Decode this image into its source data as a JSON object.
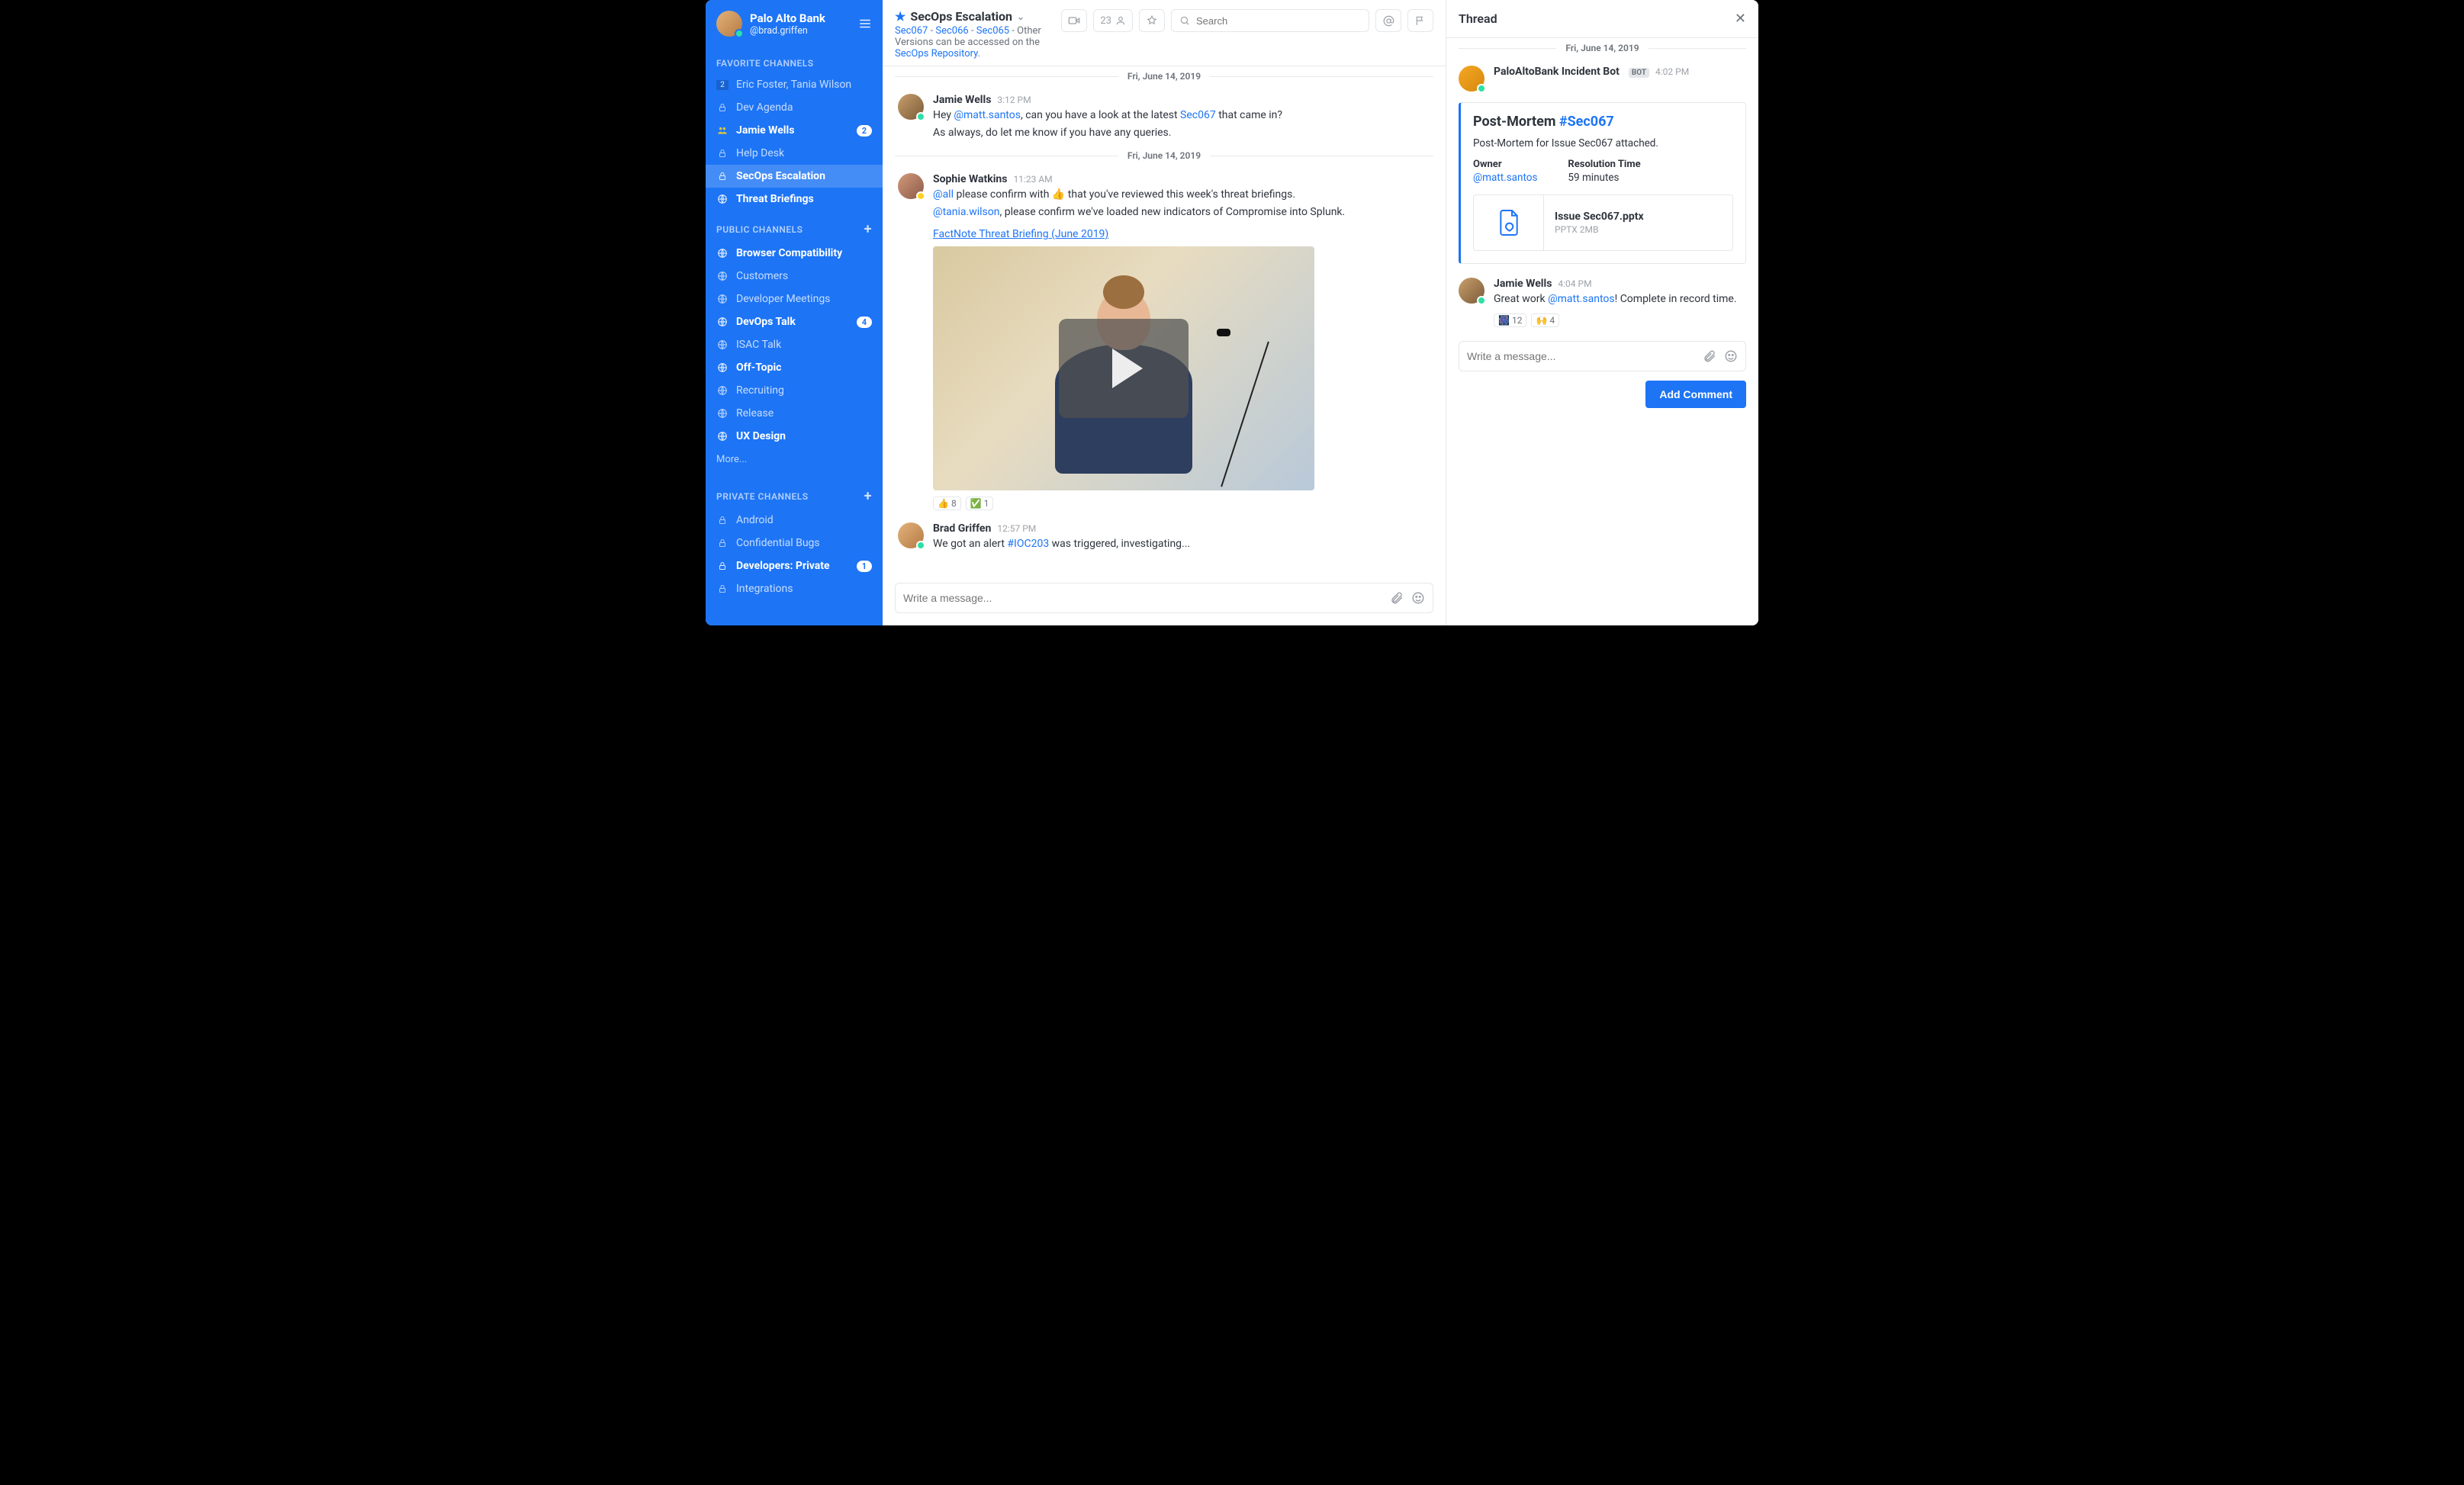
{
  "org": {
    "name": "Palo Alto Bank",
    "handle": "@brad.griffen"
  },
  "sidebar": {
    "sections": {
      "favorites": {
        "title": "FAVORITE CHANNELS"
      },
      "public": {
        "title": "PUBLIC CHANNELS"
      },
      "private": {
        "title": "PRIVATE CHANNELS"
      }
    },
    "favorites": [
      {
        "label": "Eric Foster, Tania Wilson",
        "badge_left": "2"
      },
      {
        "label": "Dev Agenda"
      },
      {
        "label": "Jamie Wells",
        "bold": true,
        "badge": "2"
      },
      {
        "label": "Help Desk"
      },
      {
        "label": "SecOps Escalation",
        "active": true
      },
      {
        "label": "Threat Briefings",
        "bold": true
      }
    ],
    "public": [
      {
        "label": "Browser Compatibility",
        "bold": true
      },
      {
        "label": "Customers"
      },
      {
        "label": "Developer Meetings"
      },
      {
        "label": "DevOps Talk",
        "bold": true,
        "badge": "4"
      },
      {
        "label": "ISAC Talk"
      },
      {
        "label": "Off-Topic",
        "bold": true
      },
      {
        "label": "Recruiting"
      },
      {
        "label": "Release"
      },
      {
        "label": "UX Design",
        "bold": true
      }
    ],
    "more": "More...",
    "private": [
      {
        "label": "Android"
      },
      {
        "label": "Confidential Bugs"
      },
      {
        "label": "Developers: Private",
        "bold": true,
        "badge": "1"
      },
      {
        "label": "Integrations"
      }
    ]
  },
  "channel": {
    "name": "SecOps Escalation",
    "breadcrumb_links": [
      "Sec067",
      "Sec066",
      "Sec065"
    ],
    "breadcrumb_sep": " - ",
    "breadcrumb_tail": " - Other Versions can be accessed on the ",
    "breadcrumb_repo": "SecOps Repository",
    "breadcrumb_period": "."
  },
  "topbar": {
    "member_count": "23",
    "search_placeholder": "Search"
  },
  "dates": {
    "d1": "Fri, June 14, 2019",
    "d2": "Fri, June 14, 2019"
  },
  "messages": [
    {
      "user": "Jamie Wells",
      "time": "3:12 PM",
      "line1_a": "Hey ",
      "line1_mention": "@matt.santos",
      "line1_b": ", can you have a look at the latest ",
      "line1_link": "Sec067",
      "line1_c": " that came in?",
      "line2": "As always, do let me know if you have any queries."
    },
    {
      "user": "Sophie Watkins",
      "time": "11:23 AM",
      "line1_a": "@all",
      "line1_b": " please confirm with 👍 that you've reviewed this week's threat briefings.",
      "line2_a": "@tania.wilson",
      "line2_b": ", please confirm we've loaded new indicators of Compromise into Splunk.",
      "attachment": "FactNote Threat Briefing (June 2019)",
      "reactions": [
        {
          "emoji": "👍",
          "count": "8"
        },
        {
          "emoji": "✅",
          "count": "1"
        }
      ]
    },
    {
      "user": "Brad Griffen",
      "time": "12:57 PM",
      "line1_a": "We got an alert ",
      "line1_link": "#IOC203",
      "line1_b": " was triggered, investigating..."
    }
  ],
  "composer": {
    "placeholder": "Write a message..."
  },
  "thread": {
    "title": "Thread",
    "date": "Fri, June 14, 2019",
    "bot": {
      "name": "PaloAltoBank Incident Bot",
      "tag": "BOT",
      "time": "4:02 PM"
    },
    "card": {
      "title_a": "Post-Mortem ",
      "title_hash": "#Sec067",
      "subtitle": "Post-Mortem for Issue Sec067 attached.",
      "owner_label": "Owner",
      "owner_value": "@matt.santos",
      "res_label": "Resolution Time",
      "res_value": "59 minutes",
      "file_name": "Issue Sec067.pptx",
      "file_meta": "PPTX 2MB"
    },
    "reply": {
      "user": "Jamie Wells",
      "time": "4:04 PM",
      "text_a": "Great work ",
      "mention": "@matt.santos",
      "text_b": "! Complete in record time.",
      "reactions": [
        {
          "emoji": "🎆",
          "count": "12"
        },
        {
          "emoji": "🙌",
          "count": "4"
        }
      ]
    },
    "composer_placeholder": "Write a message...",
    "button": "Add Comment"
  }
}
